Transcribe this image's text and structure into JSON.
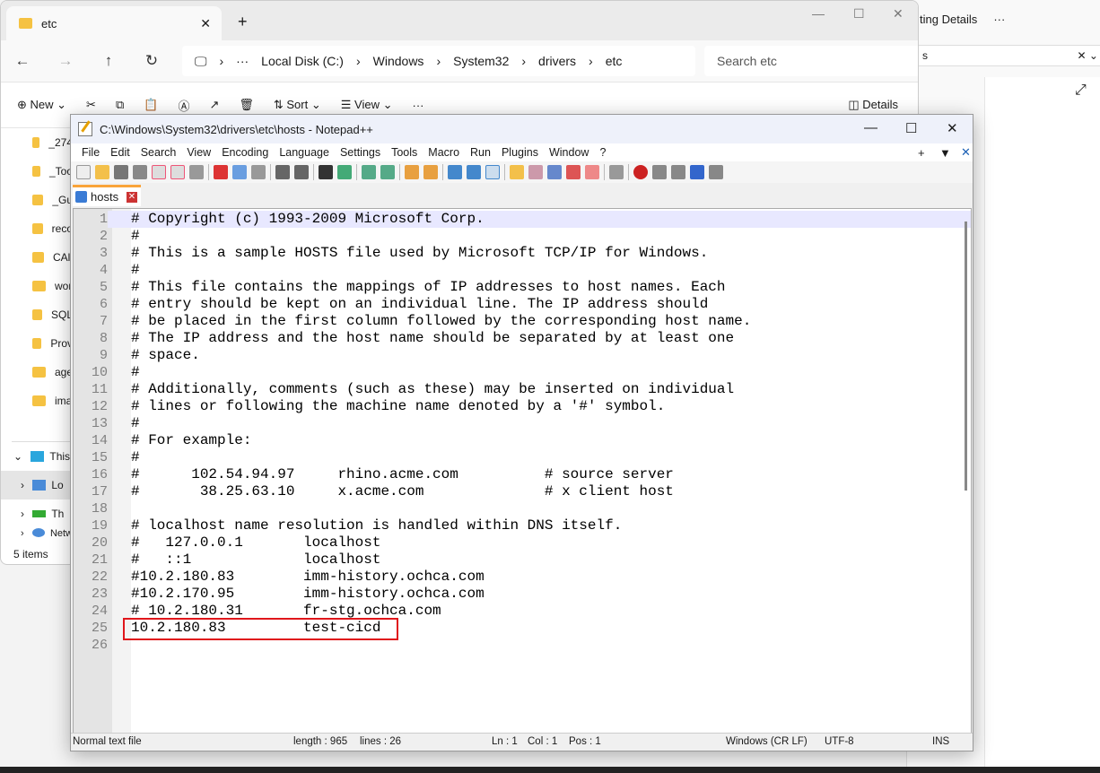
{
  "background_window": {
    "title_fragment": "ting Details",
    "more": "···",
    "search_fragment": "s"
  },
  "explorer": {
    "tab_title": "etc",
    "breadcrumb": [
      "Local Disk (C:)",
      "Windows",
      "System32",
      "drivers",
      "etc"
    ],
    "search_placeholder": "Search etc",
    "commands": {
      "new": "New",
      "sort": "Sort",
      "view": "View",
      "more": "···",
      "details": "Details"
    },
    "sidebar": [
      "_274",
      "_Too",
      "_Gu",
      "reco",
      "CAll",
      "wor",
      "SQL",
      "Prov",
      "age",
      "ima",
      "This",
      "Lo",
      "Th",
      "Netw"
    ],
    "status": "5 items"
  },
  "notepad": {
    "title": "C:\\Windows\\System32\\drivers\\etc\\hosts - Notepad++",
    "menu": [
      "File",
      "Edit",
      "Search",
      "View",
      "Encoding",
      "Language",
      "Settings",
      "Tools",
      "Macro",
      "Run",
      "Plugins",
      "Window",
      "?"
    ],
    "tab": "hosts",
    "lines": [
      "# Copyright (c) 1993-2009 Microsoft Corp.",
      "#",
      "# This is a sample HOSTS file used by Microsoft TCP/IP for Windows.",
      "#",
      "# This file contains the mappings of IP addresses to host names. Each",
      "# entry should be kept on an individual line. The IP address should",
      "# be placed in the first column followed by the corresponding host name.",
      "# The IP address and the host name should be separated by at least one",
      "# space.",
      "#",
      "# Additionally, comments (such as these) may be inserted on individual",
      "# lines or following the machine name denoted by a '#' symbol.",
      "#",
      "# For example:",
      "#",
      "#      102.54.94.97     rhino.acme.com          # source server",
      "#       38.25.63.10     x.acme.com              # x client host",
      "",
      "# localhost name resolution is handled within DNS itself.",
      "#   127.0.0.1       localhost",
      "#   ::1             localhost",
      "#10.2.180.83        imm-history.ochca.com",
      "#10.2.170.95        imm-history.ochca.com",
      "# 10.2.180.31       fr-stg.ochca.com",
      "10.2.180.83         test-cicd",
      ""
    ],
    "status": {
      "type": "Normal text file",
      "length": "length : 965",
      "lines": "lines : 26",
      "ln": "Ln : 1",
      "col": "Col : 1",
      "pos": "Pos : 1",
      "eol": "Windows (CR LF)",
      "encoding": "UTF-8",
      "mode": "INS"
    }
  },
  "colors": {
    "highlight_box": "#e0161b",
    "tab_accent": "#f9a43a",
    "current_line": "#e8e8ff"
  }
}
